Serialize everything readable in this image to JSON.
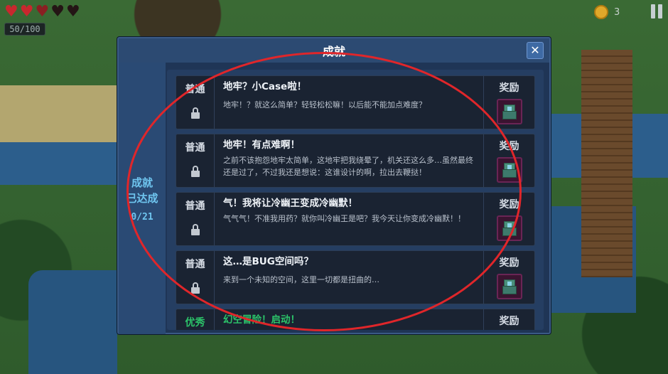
{
  "hud": {
    "hp_text": "50/100",
    "coins": "3",
    "hearts": [
      "full",
      "full",
      "half",
      "empty",
      "empty"
    ]
  },
  "dialog": {
    "title": "成就",
    "close_label": "✕",
    "side_label_line1": "成就",
    "side_label_line2": "已达成",
    "progress": "0/21"
  },
  "achievements": [
    {
      "category": "普通",
      "title": "地牢？小Case啦！",
      "description": "地牢！？就这么简单？轻轻松松嘛！以后能不能加点难度？",
      "reward_label": "奖励"
    },
    {
      "category": "普通",
      "title": "地牢！有点难啊！",
      "description": "之前不该抱怨地牢太简单，这地牢把我绕晕了，机关还这么多…虽然最终还是过了，不过我还是想说：这谁设计的啊，拉出去鞭挞！",
      "reward_label": "奖励"
    },
    {
      "category": "普通",
      "title": "气！我将让冷幽王变成冷幽默！",
      "description": "气气气！不准我用药？就你叫冷幽王是吧？我今天让你变成冷幽默！！",
      "reward_label": "奖励"
    },
    {
      "category": "普通",
      "title": "这…是BUG空间吗？",
      "description": "来到一个未知的空间，这里一切都是扭曲的…",
      "reward_label": "奖励"
    },
    {
      "category": "优秀",
      "title": "幻空冒险！启动！",
      "description": "",
      "reward_label": "奖励"
    }
  ],
  "colors": {
    "dialog_bg": "#1f3556",
    "accent_blue": "#6fc5ef",
    "excellent_green": "#2cc56a",
    "annotation_red": "#e0262a"
  }
}
